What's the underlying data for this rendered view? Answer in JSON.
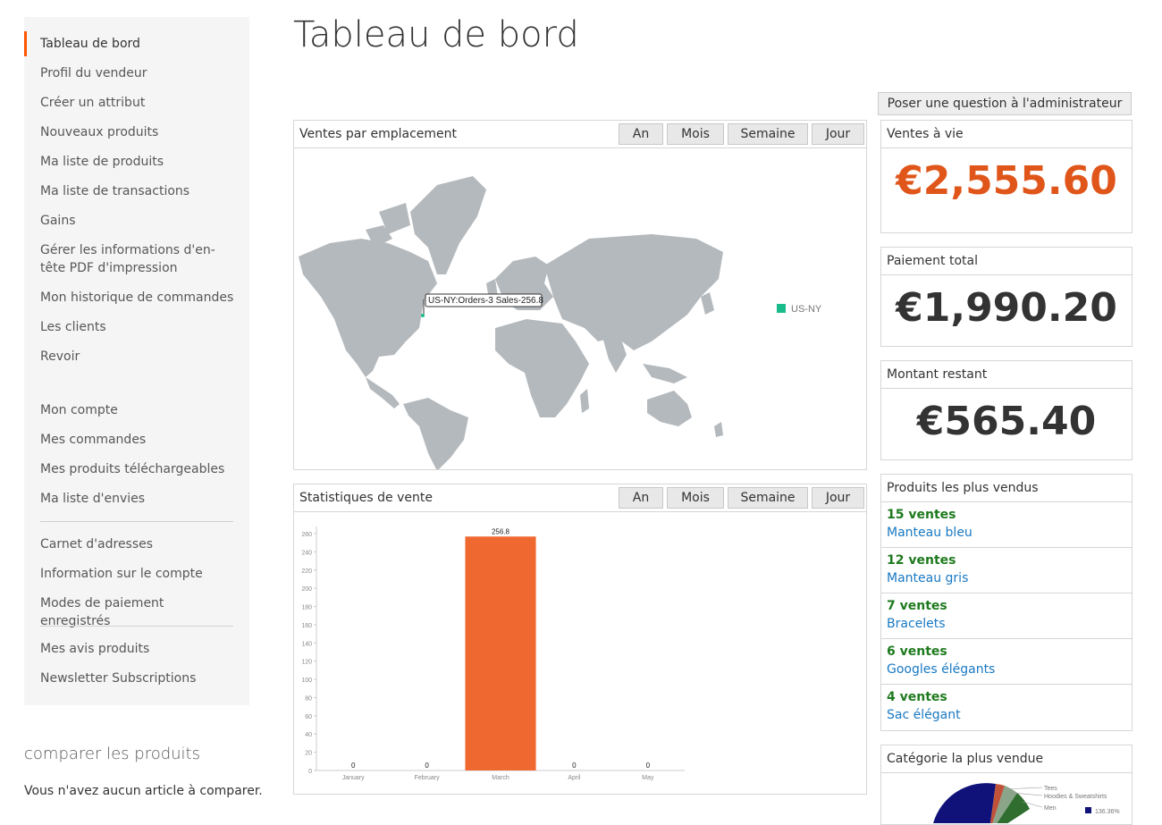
{
  "sidebar": {
    "items": [
      {
        "label": "Tableau de bord"
      },
      {
        "label": "Profil du vendeur"
      },
      {
        "label": "Créer un attribut"
      },
      {
        "label": "Nouveaux produits"
      },
      {
        "label": "Ma liste de produits"
      },
      {
        "label": "Ma liste de transactions"
      },
      {
        "label": "Gains"
      },
      {
        "label": "Gérer les informations d'en-tête PDF d'impression"
      },
      {
        "label": "Mon historique de commandes"
      },
      {
        "label": "Les clients"
      },
      {
        "label": "Revoir"
      }
    ],
    "account_items": [
      {
        "label": "Mon compte"
      },
      {
        "label": "Mes commandes"
      },
      {
        "label": "Mes produits téléchargeables"
      },
      {
        "label": "Ma liste d'envies"
      }
    ],
    "address_items": [
      {
        "label": "Carnet d'adresses"
      },
      {
        "label": "Information sur le compte"
      },
      {
        "label": "Modes de paiement enregistrés"
      }
    ],
    "review_items": [
      {
        "label": "Mes avis produits"
      },
      {
        "label": "Newsletter Subscriptions"
      }
    ],
    "accent_color": "#ff5501"
  },
  "compare": {
    "title": "comparer les produits",
    "empty_text": "Vous n'avez aucun article à comparer."
  },
  "page": {
    "title": "Tableau de bord",
    "ask_admin_label": "Poser une question à l'administrateur"
  },
  "period_tabs": [
    "An",
    "Mois",
    "Semaine",
    "Jour"
  ],
  "map_panel": {
    "title": "Ventes par emplacement",
    "tooltip": "US-NY:Orders-3 Sales-256.8",
    "legend_label": "US-NY",
    "legend_color": "#1abc8c"
  },
  "stats_panel": {
    "title": "Statistiques de vente"
  },
  "chart_data": {
    "type": "bar",
    "categories": [
      "January",
      "February",
      "March",
      "April",
      "May"
    ],
    "values": [
      0,
      0,
      256.8,
      0,
      0
    ],
    "data_labels": [
      "0",
      "0",
      "256.8",
      "0",
      "0"
    ],
    "ylim": [
      0,
      260
    ],
    "yticks": [
      0,
      20,
      40,
      60,
      80,
      100,
      120,
      140,
      160,
      180,
      200,
      220,
      240,
      260
    ],
    "bar_color": "#ef6830",
    "grid": false
  },
  "lifetime_sales": {
    "title": "Ventes à vie",
    "value": "€2,555.60",
    "color": "#e0561a"
  },
  "total_payment": {
    "title": "Paiement total",
    "value": "€1,990.20",
    "color": "#333333"
  },
  "remaining": {
    "title": "Montant restant",
    "value": "€565.40",
    "color": "#333333"
  },
  "best_products": {
    "title": "Produits les plus vendus",
    "items": [
      {
        "sales": "15 ventes",
        "name": "Manteau bleu"
      },
      {
        "sales": "12 ventes",
        "name": "Manteau gris"
      },
      {
        "sales": "7 ventes",
        "name": "Bracelets"
      },
      {
        "sales": "6 ventes",
        "name": "Googles élégants"
      },
      {
        "sales": "4 ventes",
        "name": "Sac élégant"
      }
    ]
  },
  "best_category": {
    "title": "Catégorie la plus vendue",
    "pie_labels": [
      "Tees",
      "Hoodies & Sweatshirts",
      "Men"
    ],
    "legend_value": "136.36%"
  }
}
